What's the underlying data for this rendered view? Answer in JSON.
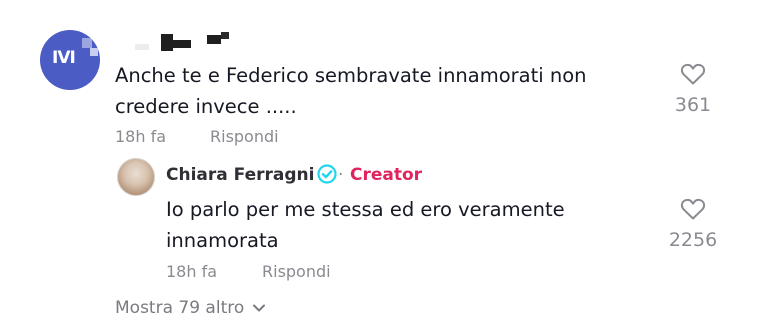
{
  "comment": {
    "avatar_text": "IVI",
    "text": "Anche te e Federico sembravate innamorati non credere invece .....",
    "time": "18h fa",
    "reply_label": "Rispondi",
    "likes": "361"
  },
  "reply": {
    "author": "Chiara Ferragni",
    "separator": "·",
    "badge": "Creator",
    "text": "Io parlo per me stessa ed ero veramente innamorata",
    "time": "18h fa",
    "reply_label": "Rispondi",
    "likes": "2256"
  },
  "footer": {
    "show_more": "Mostra 79 altro"
  },
  "colors": {
    "avatar_bg": "#4b5cc4",
    "creator_accent": "#e0245e",
    "verified": "#20d5ec",
    "muted_text": "#8a8b91"
  },
  "icons": {
    "like": "heart-outline-icon",
    "verified": "verified-check-icon",
    "expand": "chevron-down-icon"
  }
}
